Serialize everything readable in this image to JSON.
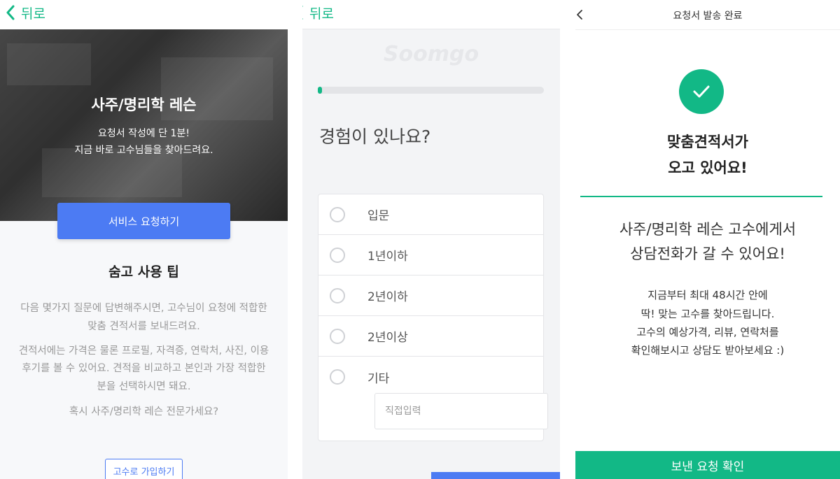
{
  "panel1": {
    "back_label": "뒤로",
    "hero": {
      "title": "사주/명리학 레슨",
      "subtitle_line1": "요청서 작성에 단 1분!",
      "subtitle_line2": "지금 바로 고수님들을 찾아드려요."
    },
    "request_button": "서비스 요청하기",
    "tips": {
      "title": "숨고 사용 팁",
      "p1_line1": "다음 몇가지 질문에 답변해주시면, 고수님이 요청에 적합한",
      "p1_line2": "맞춤 견적서를 보내드려요.",
      "p2_line1": "견적서에는 가격은 물론 프로필, 자격증, 연락처, 사진, 이용",
      "p2_line2": "후기를 볼 수 있어요. 견적을 비교하고 본인과 가장 적합한",
      "p2_line3": "분을 선택하시면 돼요.",
      "p3": "혹시 사주/명리학 레슨 전문가세요?"
    },
    "signup_button": "고수로 가입하기"
  },
  "panel2": {
    "back_label": "뒤로",
    "watermark": "Soomgo",
    "progress": 0.02,
    "question": "경험이 있나요?",
    "options": [
      "입문",
      "1년이하",
      "2년이하",
      "2년이상",
      "기타"
    ],
    "custom_input_placeholder": "직접입력"
  },
  "panel3": {
    "header_title": "요청서 발송 완료",
    "headline_line1": "맞춤견적서가",
    "headline_line2": "오고 있어요!",
    "sub_line1": "사주/명리학 레슨 고수에게서",
    "sub_line2": "상담전화가 갈 수 있어요!",
    "desc_line1": "지금부터 최대 48시간 안에",
    "desc_line2": "딱! 맞는 고수를 찾아드립니다.",
    "desc_line3": "고수의 예상가격, 리뷰, 연락처를",
    "desc_line4": "확인해보시고 상담도 받아보세요 :)",
    "confirm_button": "보낸 요청 확인"
  },
  "colors": {
    "brand_green": "#12b886",
    "brand_blue": "#4c7bf3"
  }
}
